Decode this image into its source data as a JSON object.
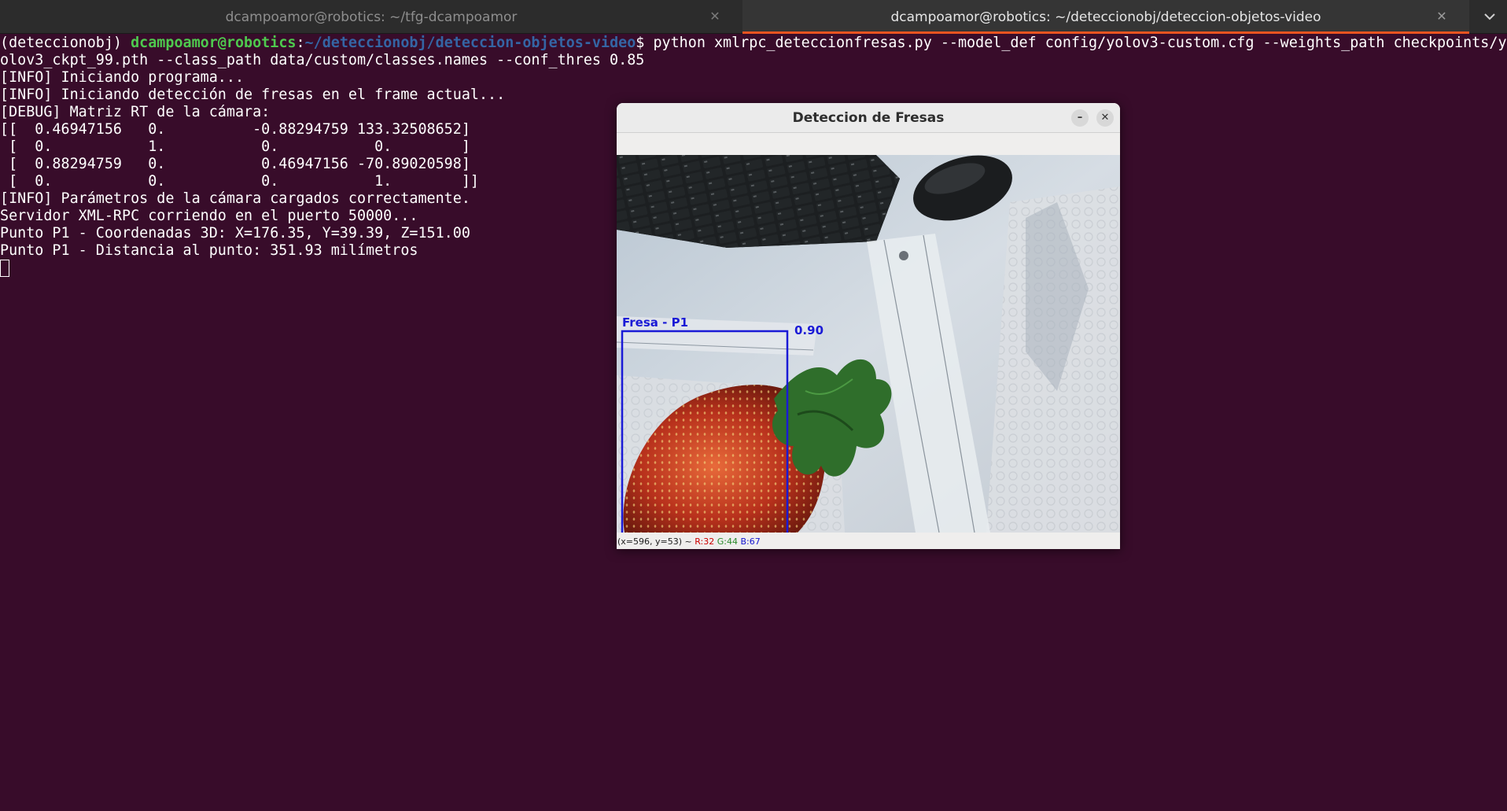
{
  "tabs": [
    {
      "title": "dcampoamor@robotics: ~/tfg-dcampoamor",
      "active": false
    },
    {
      "title": "dcampoamor@robotics: ~/deteccionobj/deteccion-objetos-video",
      "active": true
    }
  ],
  "terminal": {
    "prompt": {
      "env": "(deteccionobj) ",
      "user": "dcampoamor@robotics",
      "sep": ":",
      "path": "~/deteccionobj/deteccion-objetos-video",
      "symbol": "$ "
    },
    "command": "python xmlrpc_deteccionfresas.py --model_def config/yolov3-custom.cfg --weights_path checkpoints/y",
    "command_wrap": "olov3_ckpt_99.pth --class_path data/custom/classes.names --conf_thres 0.85",
    "output_lines": [
      "[INFO] Iniciando programa...",
      "[INFO] Iniciando detección de fresas en el frame actual...",
      "[DEBUG] Matriz RT de la cámara:",
      "[[  0.46947156   0.          -0.88294759 133.32508652]",
      " [  0.           1.           0.           0.        ]",
      " [  0.88294759   0.           0.46947156 -70.89020598]",
      " [  0.           0.           0.           1.        ]]",
      "[INFO] Parámetros de la cámara cargados correctamente.",
      "Servidor XML-RPC corriendo en el puerto 50000...",
      "Punto P1 - Coordenadas 3D: X=176.35, Y=39.39, Z=151.00",
      "Punto P1 - Distancia al punto: 351.93 milímetros"
    ]
  },
  "cv_window": {
    "title": "Deteccion de Fresas",
    "minimize_symbol": "–",
    "close_symbol": "✕",
    "detection": {
      "label": "Fresa - P1",
      "confidence": "0.90",
      "box_color": "#1a1ad6"
    },
    "status": {
      "coords": "(x=596, y=53) ~ ",
      "r": "R:32",
      "g": "G:44",
      "b": "B:67"
    }
  },
  "colors": {
    "terminal_bg": "#380c2a",
    "prompt_user": "#4ec94e",
    "prompt_path": "#3465a4",
    "tab_accent": "#e95420"
  }
}
